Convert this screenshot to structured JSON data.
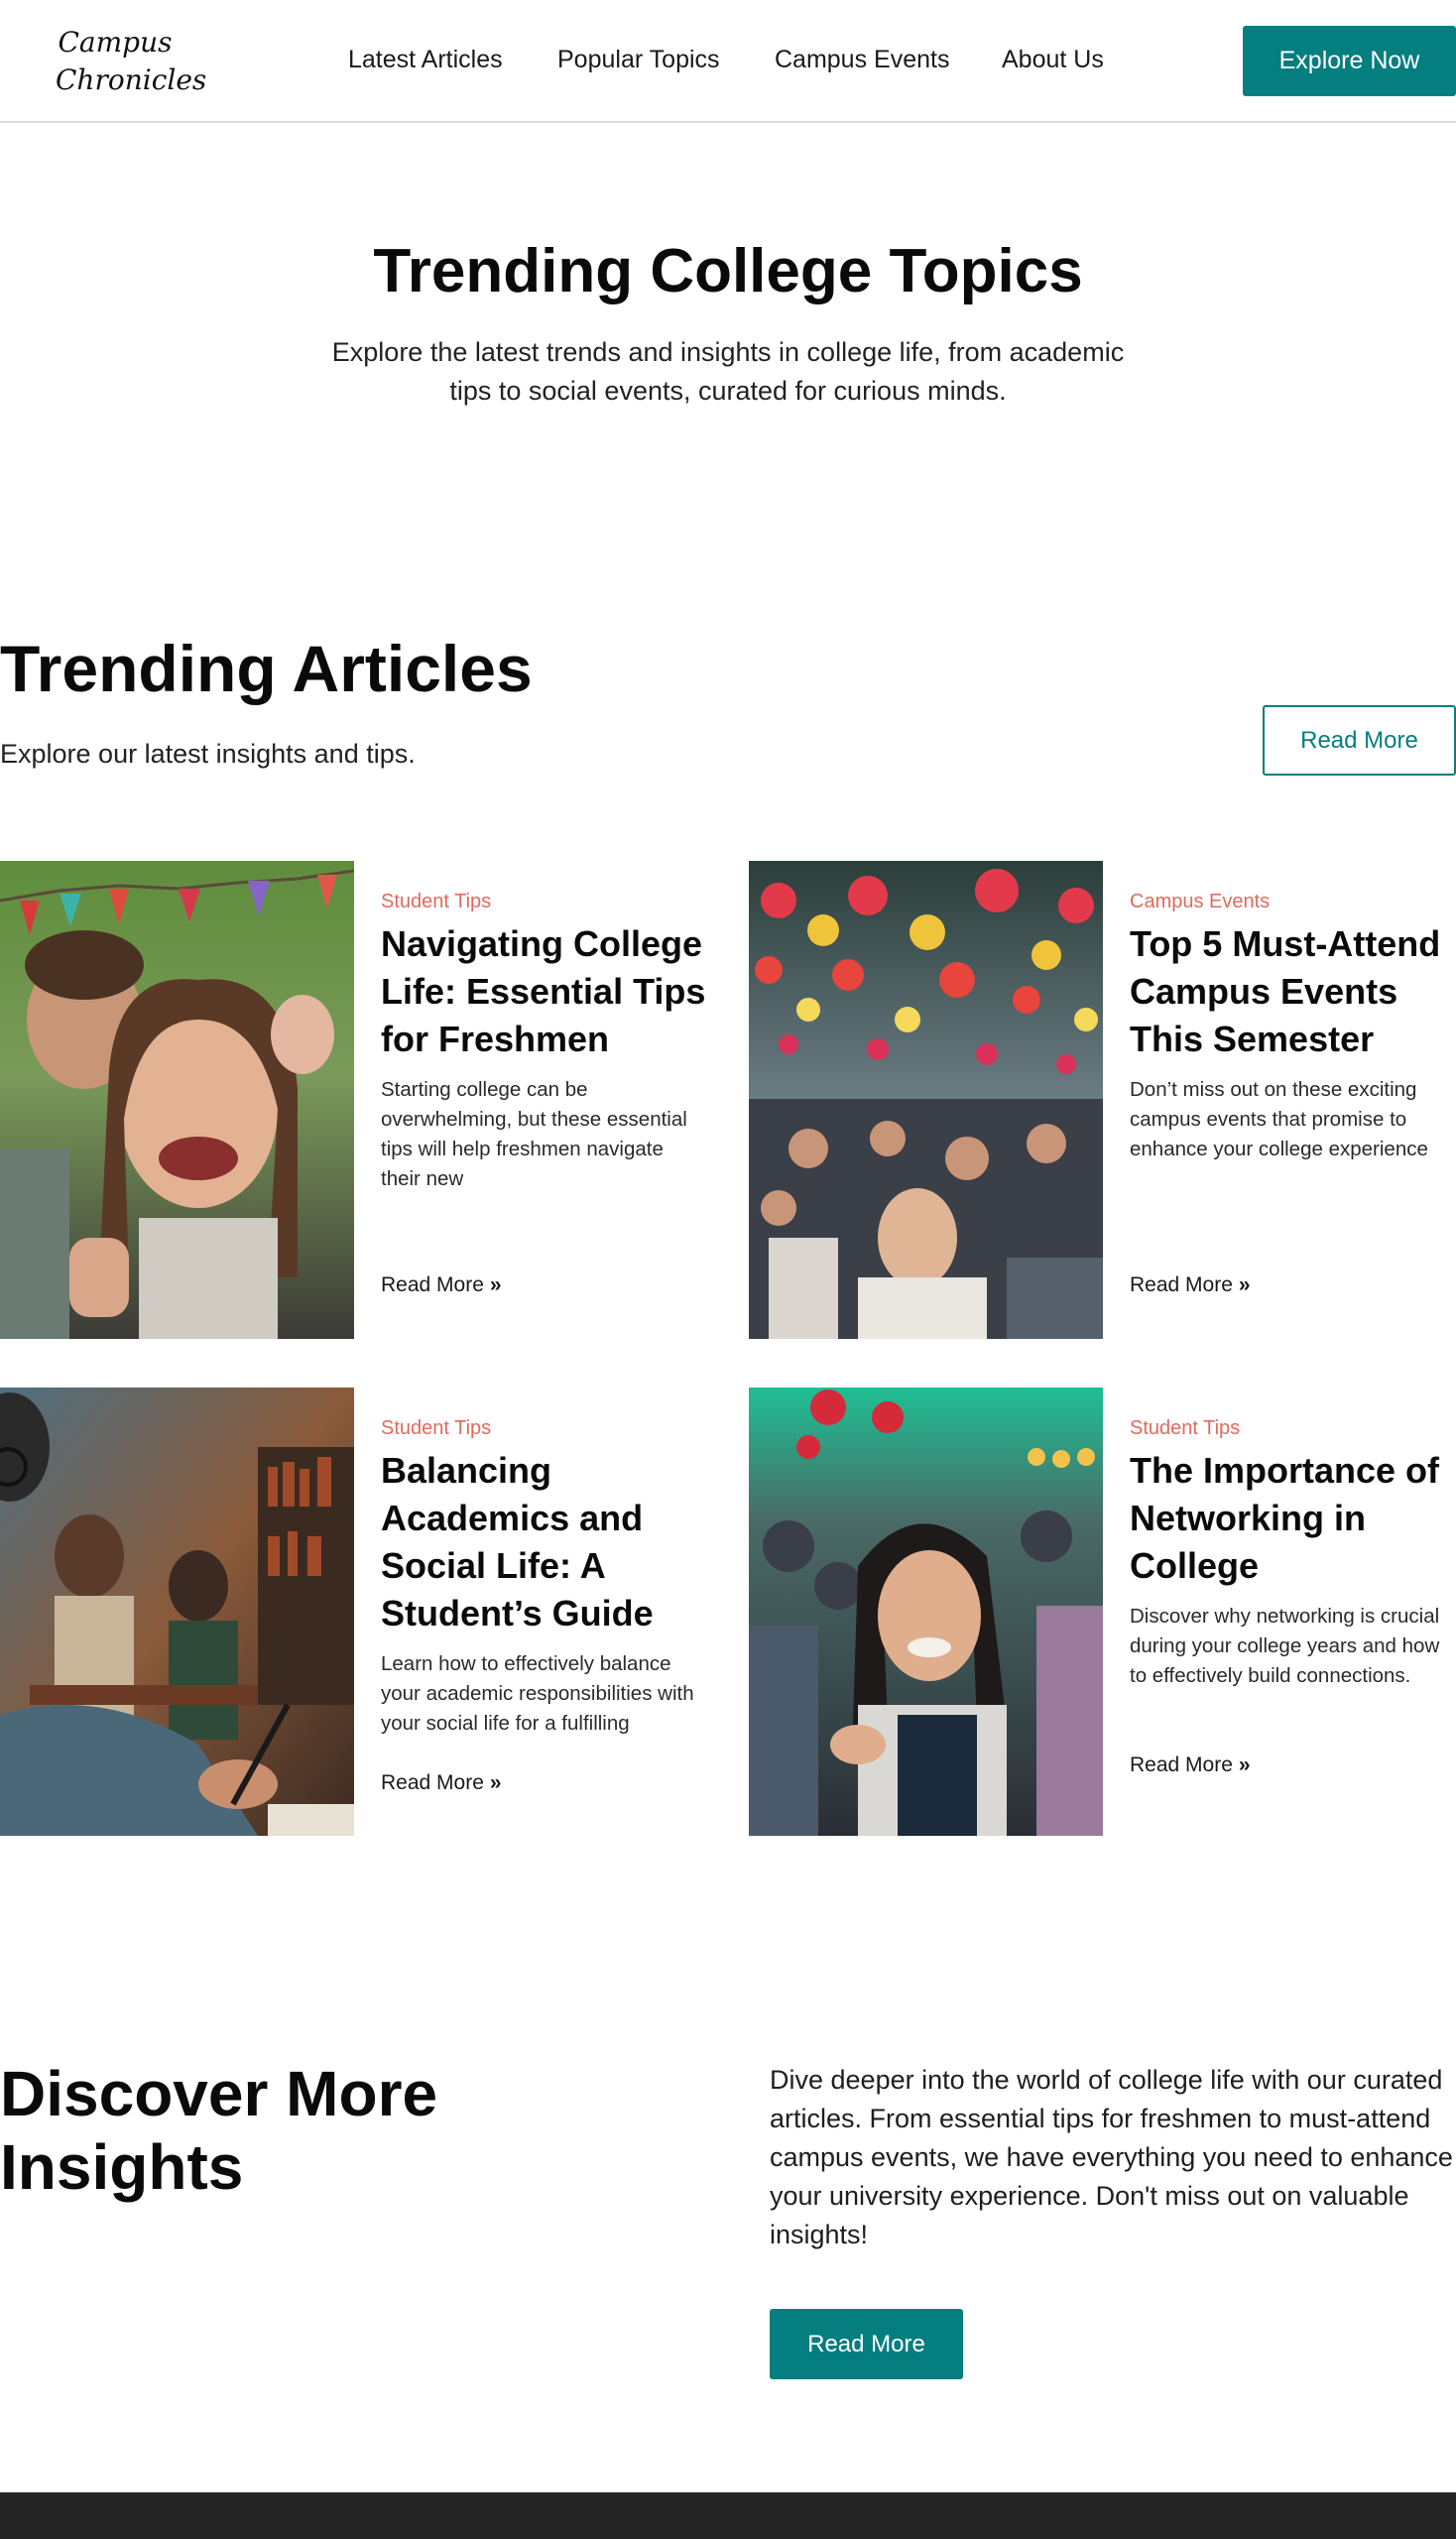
{
  "brand": {
    "logo_line1": "Campus",
    "logo_line2": "Chronicles"
  },
  "nav": {
    "items": [
      "Latest Articles",
      "Popular Topics",
      "Campus Events",
      "About Us"
    ],
    "cta_label": "Explore Now"
  },
  "hero": {
    "title": "Trending College Topics",
    "subtitle": "Explore the latest trends and insights in college life, from academic tips to social events, curated for curious minds."
  },
  "trending": {
    "title": "Trending Articles",
    "subtitle": "Explore our latest insights and tips.",
    "read_more_label": "Read More",
    "articles": [
      {
        "category": "Student Tips",
        "title": "Navigating College Life: Essential Tips for Freshmen",
        "excerpt": "Starting college can be overwhelming, but these essential tips will help freshmen navigate their new",
        "link_label": "Read More",
        "image_icon": "laughing-students-photo"
      },
      {
        "category": "Campus Events",
        "title": "Top 5 Must-Attend Campus Events This Semester",
        "excerpt": "Don’t miss out on these exciting campus events that promise to enhance your college experience",
        "link_label": "Read More",
        "image_icon": "campus-festival-crowd-photo"
      },
      {
        "category": "Student Tips",
        "title": "Balancing Academics and Social Life: A Student’s Guide",
        "excerpt": "Learn how to effectively balance your academic responsibilities with your social life for a fulfilling",
        "link_label": "Read More",
        "image_icon": "studying-library-photo"
      },
      {
        "category": "Student Tips",
        "title": "The Importance of Networking in College",
        "excerpt": "Discover why networking is crucial during your college years and how to effectively build connections.",
        "link_label": "Read More",
        "image_icon": "networking-event-photo"
      }
    ]
  },
  "discover": {
    "title": "Discover More Insights",
    "text": "Dive deeper into the world of college life with our curated articles. From essential tips for freshmen to must-attend campus events, we have everything you need to enhance your university experience. Don't miss out on valuable insights!",
    "button_label": "Read More"
  },
  "colors": {
    "accent": "#057e80",
    "category": "#e06a5c",
    "footer": "#252525"
  }
}
